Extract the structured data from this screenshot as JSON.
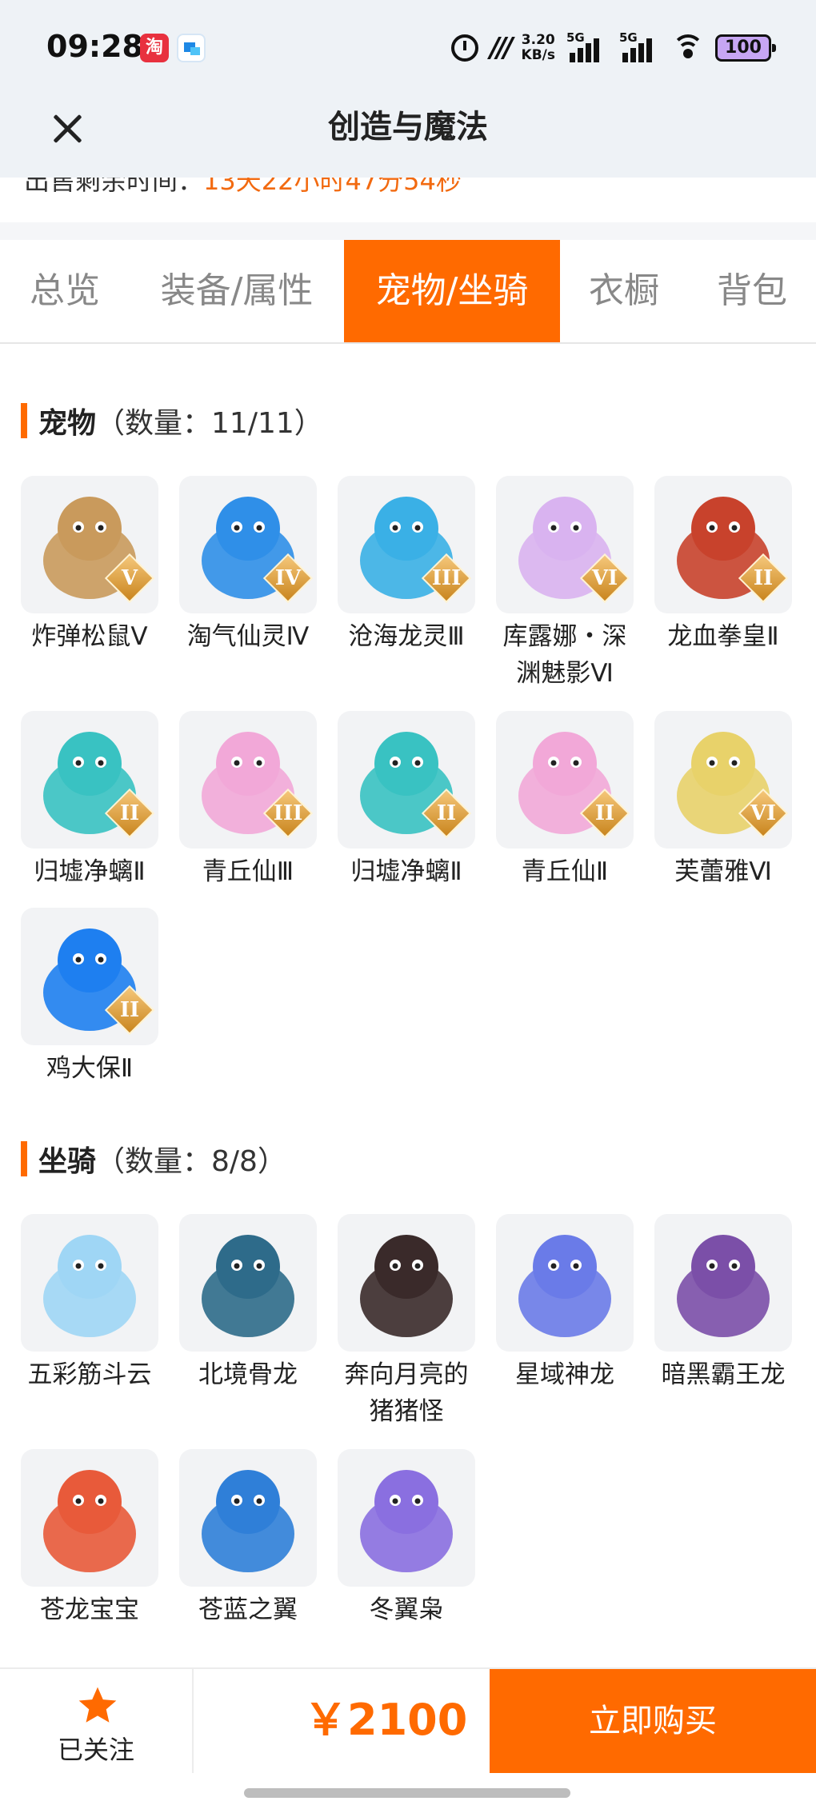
{
  "status_bar": {
    "time": "09:28",
    "network_speed": "3.20",
    "network_speed_unit": "KB/s",
    "sim1": "5G",
    "sim2": "5G",
    "battery": "100",
    "icons": [
      "taobao-app-icon",
      "blue-app-icon",
      "alarm-icon",
      "signal-icon",
      "wifi-icon",
      "battery-icon"
    ]
  },
  "header": {
    "title": "创造与魔法",
    "close_icon": "close-icon"
  },
  "countdown": {
    "label": "出售剩余时间：",
    "value": "13天22小时47分54秒"
  },
  "tabs": [
    {
      "label": "总览",
      "active": false
    },
    {
      "label": "装备/属性",
      "active": false
    },
    {
      "label": "宠物/坐骑",
      "active": true
    },
    {
      "label": "衣橱",
      "active": false
    },
    {
      "label": "背包",
      "active": false
    }
  ],
  "pets": {
    "title": "宠物",
    "count": "（数量：11/11）",
    "items": [
      {
        "name": "炸弹松鼠Ⅴ",
        "level": "V",
        "color": "#c99a5c"
      },
      {
        "name": "淘气仙灵Ⅳ",
        "level": "IV",
        "color": "#2f8fe8"
      },
      {
        "name": "沧海龙灵Ⅲ",
        "level": "III",
        "color": "#3ab0e6"
      },
      {
        "name": "库露娜・深渊魅影Ⅵ",
        "level": "VI",
        "color": "#d9b3f0"
      },
      {
        "name": "龙血拳皇Ⅱ",
        "level": "II",
        "color": "#c8422c"
      },
      {
        "name": "归墟净螭Ⅱ",
        "level": "II",
        "color": "#39c2c2"
      },
      {
        "name": "青丘仙Ⅲ",
        "level": "III",
        "color": "#f2a8d8"
      },
      {
        "name": "归墟净螭Ⅱ",
        "level": "II",
        "color": "#39c2c2"
      },
      {
        "name": "青丘仙Ⅱ",
        "level": "II",
        "color": "#f2a8d8"
      },
      {
        "name": "芙蕾雅Ⅵ",
        "level": "VI",
        "color": "#e8d26a"
      },
      {
        "name": "鸡大保Ⅱ",
        "level": "II",
        "color": "#1e7ff0"
      }
    ]
  },
  "mounts": {
    "title": "坐骑",
    "count": "（数量：8/8）",
    "items": [
      {
        "name": "五彩筋斗云",
        "color": "#9fd6f5"
      },
      {
        "name": "北境骨龙",
        "color": "#2e6b8a"
      },
      {
        "name": "奔向月亮的猪猪怪",
        "color": "#3a2a2a"
      },
      {
        "name": "星域神龙",
        "color": "#6a7be8"
      },
      {
        "name": "暗黑霸王龙",
        "color": "#7b4fa8"
      },
      {
        "name": "苍龙宝宝",
        "color": "#e85a3a"
      },
      {
        "name": "苍蓝之翼",
        "color": "#2f7fd8"
      },
      {
        "name": "冬翼枭",
        "color": "#8a6fe0"
      }
    ]
  },
  "bottom": {
    "follow_label": "已关注",
    "price": "￥2100",
    "buy_label": "立即购买"
  },
  "colors": {
    "accent": "#ff6a00",
    "countdown": "#f26a10"
  }
}
